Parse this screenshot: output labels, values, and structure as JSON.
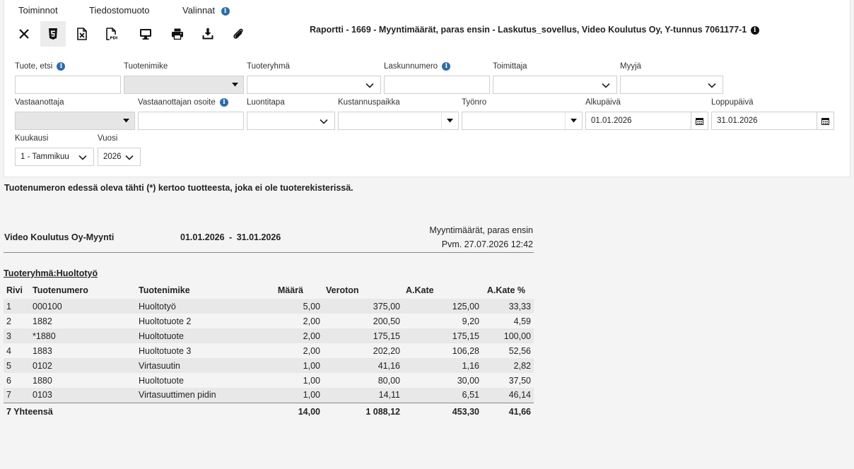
{
  "menu": {
    "toiminnot": "Toiminnot",
    "tiedostomuoto": "Tiedostomuoto",
    "valinnat": "Valinnat"
  },
  "toolbar": {
    "icons": [
      "close-icon",
      "html5-icon",
      "excel-icon",
      "pdf-icon",
      "monitor-icon",
      "print-icon",
      "download-icon",
      "attachment-icon"
    ]
  },
  "report_title": "Raportti - 1669 - Myyntimäärät, paras ensin - Laskutus_sovellus, Video Koulutus Oy, Y-tunnus 7061177-1",
  "filters": {
    "tuote_etsi": {
      "label": "Tuote, etsi",
      "value": ""
    },
    "tuotenimike": {
      "label": "Tuotenimike",
      "value": ""
    },
    "tuoteryhma": {
      "label": "Tuoteryhmä",
      "value": ""
    },
    "laskunnumero": {
      "label": "Laskunnumero",
      "value": ""
    },
    "toimittaja": {
      "label": "Toimittaja",
      "value": ""
    },
    "myyja": {
      "label": "Myyjä",
      "value": ""
    },
    "vastaanottaja": {
      "label": "Vastaanottaja",
      "value": ""
    },
    "vastaanottajan_osoite": {
      "label": "Vastaanottajan osoite",
      "value": ""
    },
    "luontitapa": {
      "label": "Luontitapa",
      "value": ""
    },
    "kustannuspaikka": {
      "label": "Kustannuspaikka",
      "value": ""
    },
    "tyonro": {
      "label": "Työnro",
      "value": ""
    },
    "alkupaiva": {
      "label": "Alkupäivä",
      "value": "01.01.2026"
    },
    "loppupaiva": {
      "label": "Loppupäivä",
      "value": "31.01.2026"
    },
    "kuukausi": {
      "label": "Kuukausi",
      "value": "1 - Tammikuu"
    },
    "vuosi": {
      "label": "Vuosi",
      "value": "2026"
    }
  },
  "note": "Tuotenumeron edessä oleva tähti (*) kertoo tuotteesta, joka ei ole tuoterekisterissä.",
  "report_header": {
    "company": "Video Koulutus Oy-Myynti",
    "date_from": "01.01.2026",
    "date_sep": "-",
    "date_to": "31.01.2026",
    "report_name": "Myyntimäärät, paras ensin",
    "printed": "Pvm. 27.07.2026 12:42"
  },
  "group_title": "Tuoteryhmä:Huoltotyö",
  "columns": [
    "Rivi",
    "Tuotenumero",
    "Tuotenimike",
    "Määrä",
    "Veroton",
    "A.Kate",
    "A.Kate %"
  ],
  "rows": [
    {
      "rivi": "1",
      "tuotenumero": "000100",
      "tuotenimike": "Huoltotyö",
      "maara": "5,00",
      "veroton": "375,00",
      "akate": "125,00",
      "akate_pct": "33,33"
    },
    {
      "rivi": "2",
      "tuotenumero": "1882",
      "tuotenimike": "Huoltotuote 2",
      "maara": "2,00",
      "veroton": "200,50",
      "akate": "9,20",
      "akate_pct": "4,59"
    },
    {
      "rivi": "3",
      "tuotenumero": "*1880",
      "tuotenimike": "Huoltotuote",
      "maara": "2,00",
      "veroton": "175,15",
      "akate": "175,15",
      "akate_pct": "100,00"
    },
    {
      "rivi": "4",
      "tuotenumero": "1883",
      "tuotenimike": "Huoltotuote 3",
      "maara": "2,00",
      "veroton": "202,20",
      "akate": "106,28",
      "akate_pct": "52,56"
    },
    {
      "rivi": "5",
      "tuotenumero": "0102",
      "tuotenimike": "Virtasuutin",
      "maara": "1,00",
      "veroton": "41,16",
      "akate": "1,16",
      "akate_pct": "2,82"
    },
    {
      "rivi": "6",
      "tuotenumero": "1880",
      "tuotenimike": "Huoltotuote",
      "maara": "1,00",
      "veroton": "80,00",
      "akate": "30,00",
      "akate_pct": "37,50"
    },
    {
      "rivi": "7",
      "tuotenumero": "0103",
      "tuotenimike": "Virtasuuttimen pidin",
      "maara": "1,00",
      "veroton": "14,11",
      "akate": "6,51",
      "akate_pct": "46,14"
    }
  ],
  "totals": {
    "label": "7 Yhteensä",
    "maara": "14,00",
    "veroton": "1 088,12",
    "akate": "453,30",
    "akate_pct": "41,66"
  }
}
